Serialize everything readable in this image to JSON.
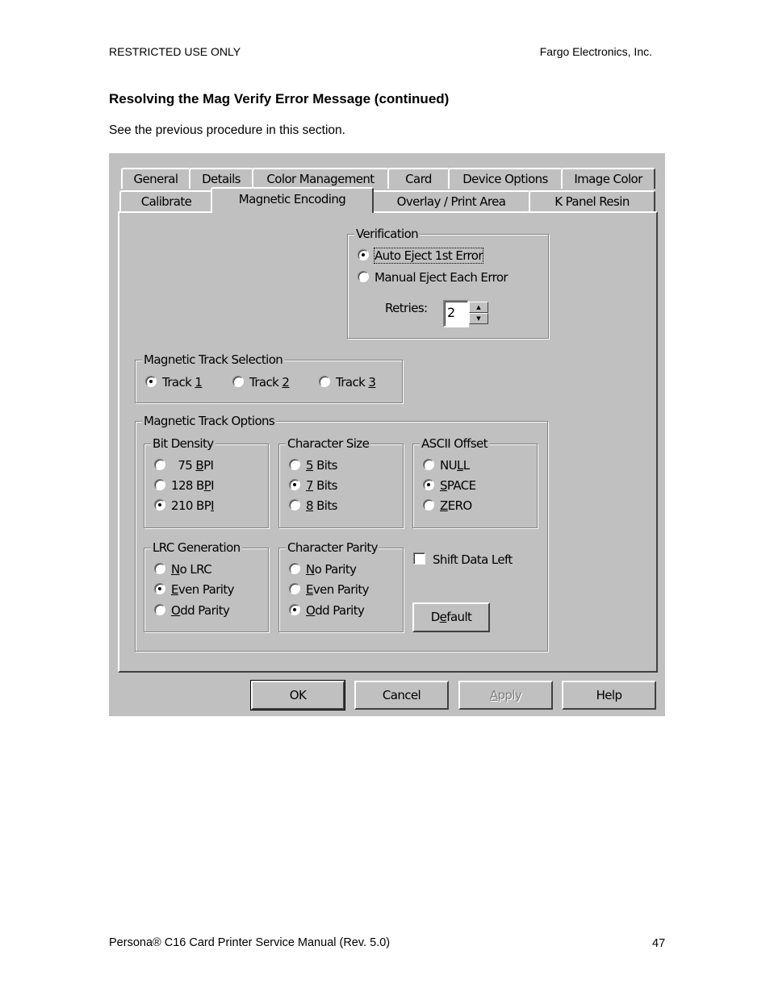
{
  "header": {
    "left": "RESTRICTED USE ONLY",
    "right": "Fargo Electronics, Inc."
  },
  "section_title": "Resolving the Mag Verify Error Message (continued)",
  "intro": "See the previous procedure in this section.",
  "dialog": {
    "tabs_row1": [
      "General",
      "Details",
      "Color Management",
      "Card",
      "Device Options",
      "Image Color"
    ],
    "tabs_row2": [
      "Calibrate",
      "Magnetic Encoding",
      "Overlay / Print Area",
      "K Panel Resin"
    ],
    "active_tab": "Magnetic Encoding",
    "verification": {
      "title": "Verification",
      "options": [
        {
          "label": "Auto Eject 1st Error",
          "selected": true
        },
        {
          "label": "Manual Eject Each Error",
          "selected": false
        }
      ],
      "retries_label": "Retries:",
      "retries_value": "2",
      "spin_up": "▲",
      "spin_down": "▼"
    },
    "track_selection": {
      "title": "Magnetic Track Selection",
      "options": [
        {
          "pre": "Track ",
          "key": "1",
          "selected": true
        },
        {
          "pre": "Track ",
          "key": "2",
          "selected": false
        },
        {
          "pre": "Track ",
          "key": "3",
          "selected": false
        }
      ]
    },
    "track_options": {
      "title": "Magnetic Track Options",
      "bit_density": {
        "title": "Bit Density",
        "options": [
          {
            "pre": "  75 ",
            "key": "B",
            "post": "PI",
            "selected": false
          },
          {
            "pre": "128 B",
            "key": "P",
            "post": "I",
            "selected": false
          },
          {
            "pre": "210 BP",
            "key": "I",
            "post": "",
            "selected": true
          }
        ]
      },
      "character_size": {
        "title": "Character Size",
        "options": [
          {
            "pre": "",
            "key": "5",
            "post": " Bits",
            "selected": false
          },
          {
            "pre": "",
            "key": "7",
            "post": " Bits",
            "selected": true
          },
          {
            "pre": "",
            "key": "8",
            "post": " Bits",
            "selected": false
          }
        ]
      },
      "ascii_offset": {
        "title": "ASCII Offset",
        "options": [
          {
            "pre": "NU",
            "key": "L",
            "post": "L",
            "selected": false
          },
          {
            "pre": "",
            "key": "S",
            "post": "PACE",
            "selected": true
          },
          {
            "pre": "",
            "key": "Z",
            "post": "ERO",
            "selected": false
          }
        ]
      },
      "lrc_generation": {
        "title": "LRC Generation",
        "options": [
          {
            "pre": "",
            "key": "N",
            "post": "o LRC",
            "selected": false
          },
          {
            "pre": "",
            "key": "E",
            "post": "ven Parity",
            "selected": true
          },
          {
            "pre": "",
            "key": "O",
            "post": "dd Parity",
            "selected": false
          }
        ]
      },
      "character_parity": {
        "title": "Character Parity",
        "options": [
          {
            "pre": "",
            "key": "N",
            "post": "o Parity",
            "selected": false
          },
          {
            "pre": "",
            "key": "E",
            "post": "ven Parity",
            "selected": false
          },
          {
            "pre": "",
            "key": "O",
            "post": "dd Parity",
            "selected": true
          }
        ]
      },
      "shift_data_left": {
        "label": "Shift Data Left",
        "checked": false
      },
      "default_button": {
        "pre": "D",
        "key": "e",
        "post": "fault"
      }
    },
    "buttons": {
      "ok": "OK",
      "cancel": "Cancel",
      "apply_key": "A",
      "apply_rest": "pply",
      "help": "Help"
    }
  },
  "footer": {
    "left": "Persona® C16 Card Printer Service Manual (Rev. 5.0)",
    "page": "47"
  }
}
